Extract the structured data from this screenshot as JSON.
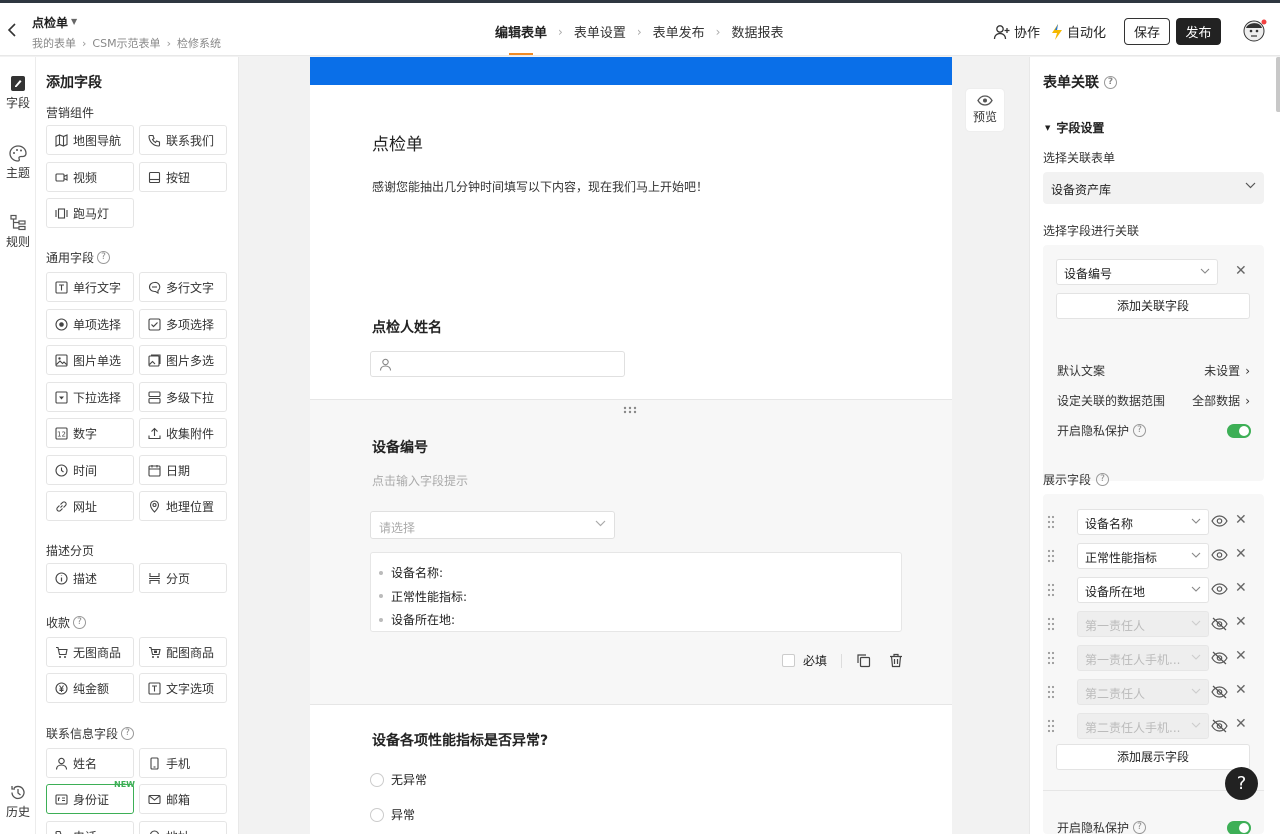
{
  "header": {
    "title": "点检单",
    "breadcrumb": [
      "我的表单",
      "CSM示范表单",
      "检修系统"
    ],
    "steps": [
      "编辑表单",
      "表单设置",
      "表单发布",
      "数据报表"
    ],
    "collab_label": "协作",
    "automation_label": "自动化",
    "save_label": "保存",
    "publish_label": "发布"
  },
  "rail": {
    "fields": "字段",
    "theme": "主题",
    "rules": "规则",
    "history": "历史"
  },
  "panel": {
    "title": "添加字段",
    "groups": [
      {
        "title": "营销组件",
        "items": [
          "地图导航",
          "联系我们",
          "视频",
          "按钮",
          "跑马灯"
        ]
      },
      {
        "title": "通用字段",
        "items": [
          "单行文字",
          "多行文字",
          "单项选择",
          "多项选择",
          "图片单选",
          "图片多选",
          "下拉选择",
          "多级下拉",
          "数字",
          "收集附件",
          "时间",
          "日期",
          "网址",
          "地理位置"
        ]
      },
      {
        "title": "描述分页",
        "items": [
          "描述",
          "分页"
        ]
      },
      {
        "title": "收款",
        "items": [
          "无图商品",
          "配图商品",
          "纯金额",
          "文字选项"
        ]
      },
      {
        "title": "联系信息字段",
        "items": [
          "姓名",
          "手机",
          "身份证",
          "邮箱",
          "电话",
          "地址"
        ]
      }
    ],
    "new_tag": "NEW"
  },
  "form": {
    "title": "点检单",
    "description": "感谢您能抽出几分钟时间填写以下内容，现在我们马上开始吧！",
    "q1": "点检人姓名",
    "q2": "设备编号",
    "q2_hint": "点击输入字段提示",
    "q2_placeholder": "请选择",
    "q2_preview": [
      "设备名称:",
      "正常性能指标:",
      "设备所在地:"
    ],
    "required_label": "必填",
    "q3": "设备各项性能指标是否异常?",
    "q3_options": [
      "无异常",
      "异常"
    ]
  },
  "preview_label": "预览",
  "right": {
    "title": "表单关联",
    "section": "字段设置",
    "select_form_label": "选择关联表单",
    "select_form_value": "设备资产库",
    "link_field_label": "选择字段进行关联",
    "link_field_value": "设备编号",
    "add_link_field": "添加关联字段",
    "default_text_label": "默认文案",
    "default_text_value": "未设置",
    "range_label": "设定关联的数据范围",
    "range_value": "全部数据",
    "privacy_label": "开启隐私保护",
    "display_label": "展示字段",
    "display_fields": [
      "设备名称",
      "正常性能指标",
      "设备所在地",
      "第一责任人",
      "第一责任人手机...",
      "第二责任人",
      "第二责任人手机..."
    ],
    "add_display_field": "添加展示字段",
    "privacy_label_2": "开启隐私保护"
  },
  "help_label": "?"
}
